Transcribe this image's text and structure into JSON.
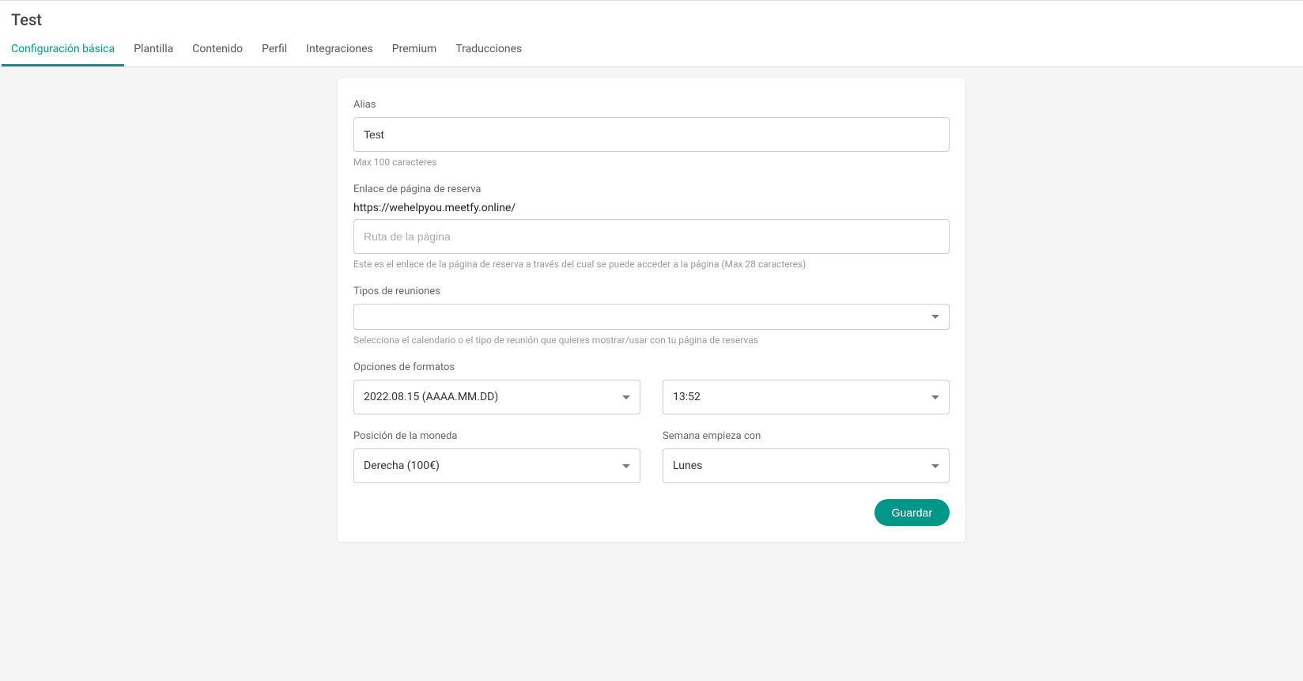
{
  "header": {
    "title": "Test",
    "tabs": [
      {
        "label": "Configuración básica",
        "active": true
      },
      {
        "label": "Plantilla",
        "active": false
      },
      {
        "label": "Contenido",
        "active": false
      },
      {
        "label": "Perfil",
        "active": false
      },
      {
        "label": "Integraciones",
        "active": false
      },
      {
        "label": "Premium",
        "active": false
      },
      {
        "label": "Traducciones",
        "active": false
      }
    ]
  },
  "form": {
    "alias": {
      "label": "Alias",
      "value": "Test",
      "helper": "Max 100 caracteres"
    },
    "booking_link": {
      "label": "Enlace de página de reserva",
      "url_prefix": "https://wehelpyou.meetfy.online/",
      "placeholder": "Ruta de la página",
      "value": "",
      "helper": "Este es el enlace de la página de reserva a través del cual se puede acceder a la página (Max 28 caracteres)"
    },
    "meeting_types": {
      "label": "Tipos de reuniones",
      "value": "",
      "helper": "Selecciona el calendario o el tipo de reunión que quieres mostrar/usar con tu página de reservas"
    },
    "format_options": {
      "label": "Opciones de formatos",
      "date_value": "2022.08.15 (AAAA.MM.DD)",
      "time_value": "13:52"
    },
    "currency_position": {
      "label": "Posición de la moneda",
      "value": "Derecha (100€)"
    },
    "week_start": {
      "label": "Semana empieza con",
      "value": "Lunes"
    },
    "save_label": "Guardar"
  }
}
